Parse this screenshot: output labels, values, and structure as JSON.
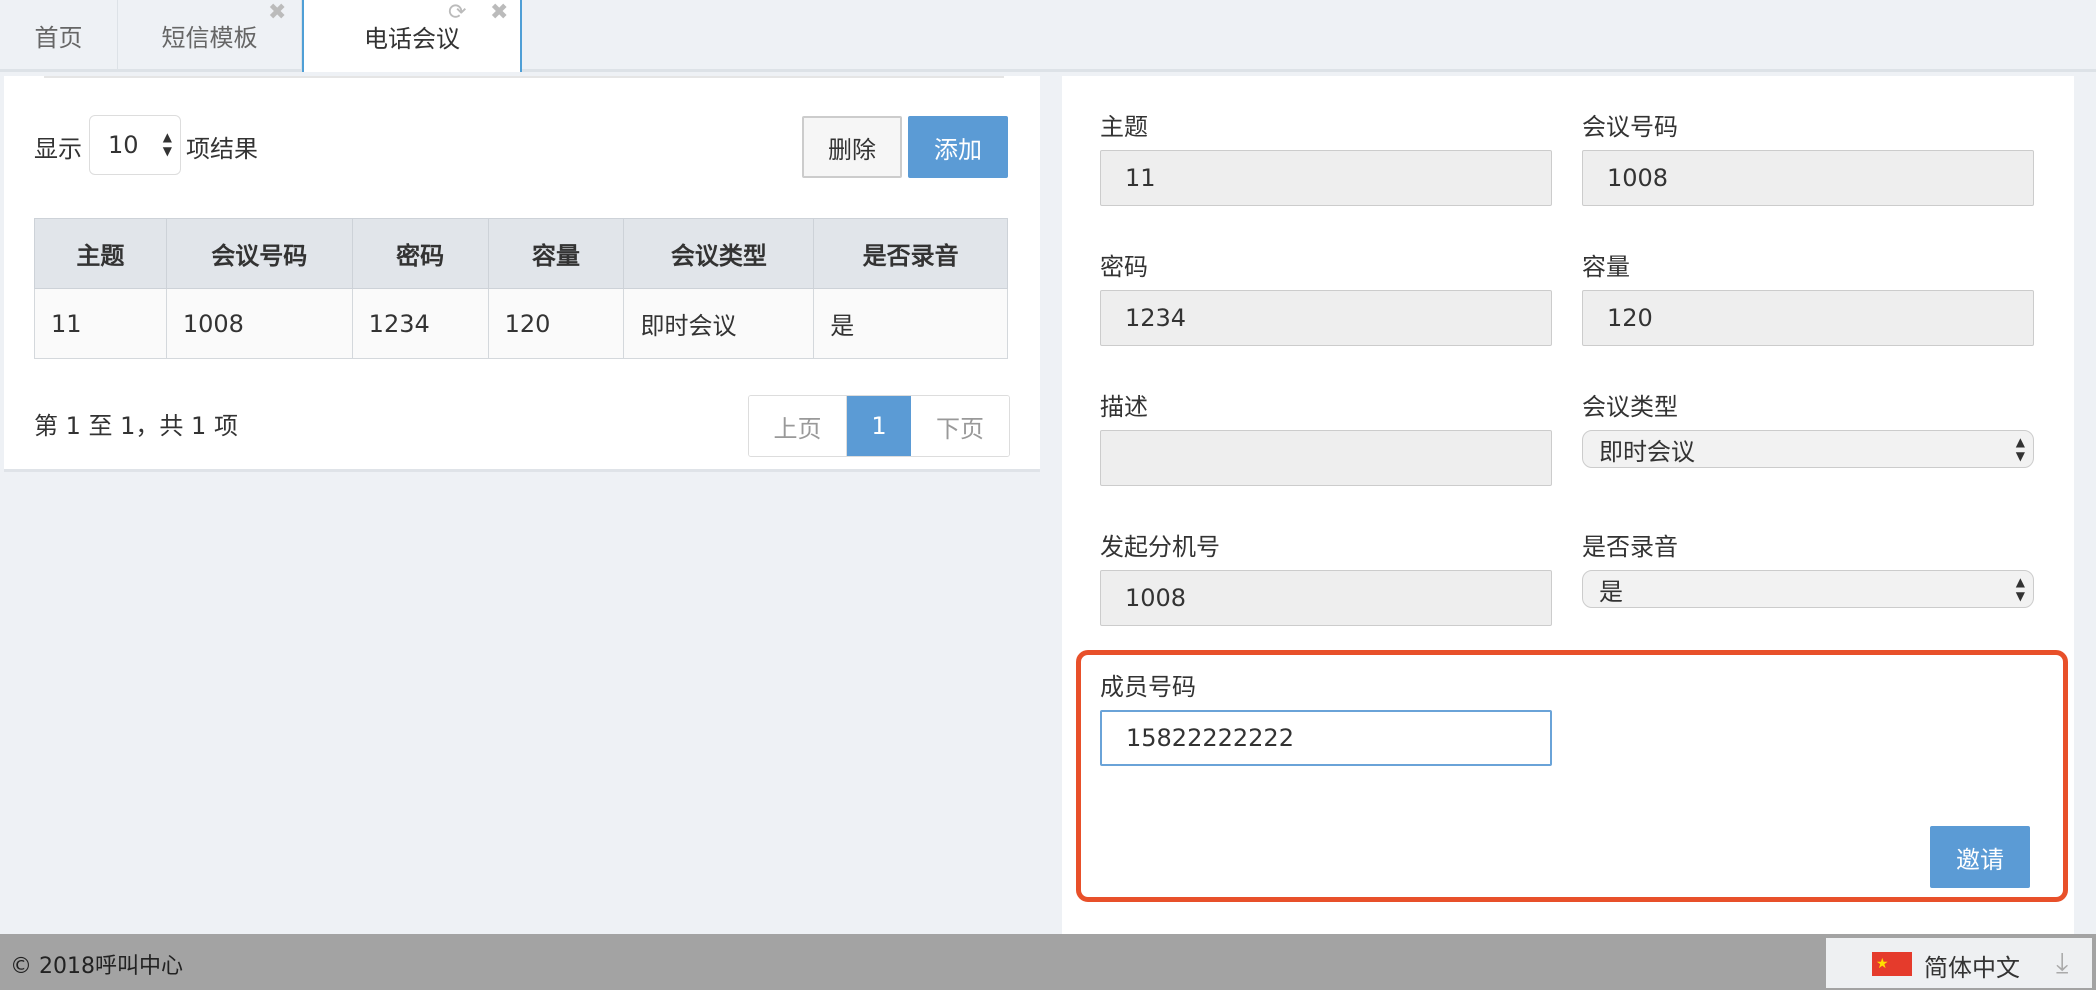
{
  "tabs": [
    {
      "label": "首页"
    },
    {
      "label": "短信模板"
    },
    {
      "label": "电话会议"
    }
  ],
  "list": {
    "show_label": "显示",
    "page_size": "10",
    "results_label": "项结果",
    "delete_label": "删除",
    "add_label": "添加",
    "columns": [
      "主题",
      "会议号码",
      "密码",
      "容量",
      "会议类型",
      "是否录音"
    ],
    "rows": [
      [
        "11",
        "1008",
        "1234",
        "120",
        "即时会议",
        "是"
      ]
    ],
    "summary": "第 1 至 1，共 1 项",
    "pager": {
      "prev": "上页",
      "current": "1",
      "next": "下页"
    }
  },
  "form": {
    "subject": {
      "label": "主题",
      "value": "11"
    },
    "conf_number": {
      "label": "会议号码",
      "value": "1008"
    },
    "password": {
      "label": "密码",
      "value": "1234"
    },
    "capacity": {
      "label": "容量",
      "value": "120"
    },
    "description": {
      "label": "描述",
      "value": ""
    },
    "conf_type": {
      "label": "会议类型",
      "value": "即时会议"
    },
    "caller_ext": {
      "label": "发起分机号",
      "value": "1008"
    },
    "record": {
      "label": "是否录音",
      "value": "是"
    },
    "member": {
      "label": "成员号码",
      "value": "15822222222"
    },
    "invite_label": "邀请"
  },
  "footer": {
    "copyright": "© 2018呼叫中心",
    "language": "简体中文"
  },
  "colors": {
    "primary": "#5b9bd5",
    "highlight": "#e8502a"
  }
}
